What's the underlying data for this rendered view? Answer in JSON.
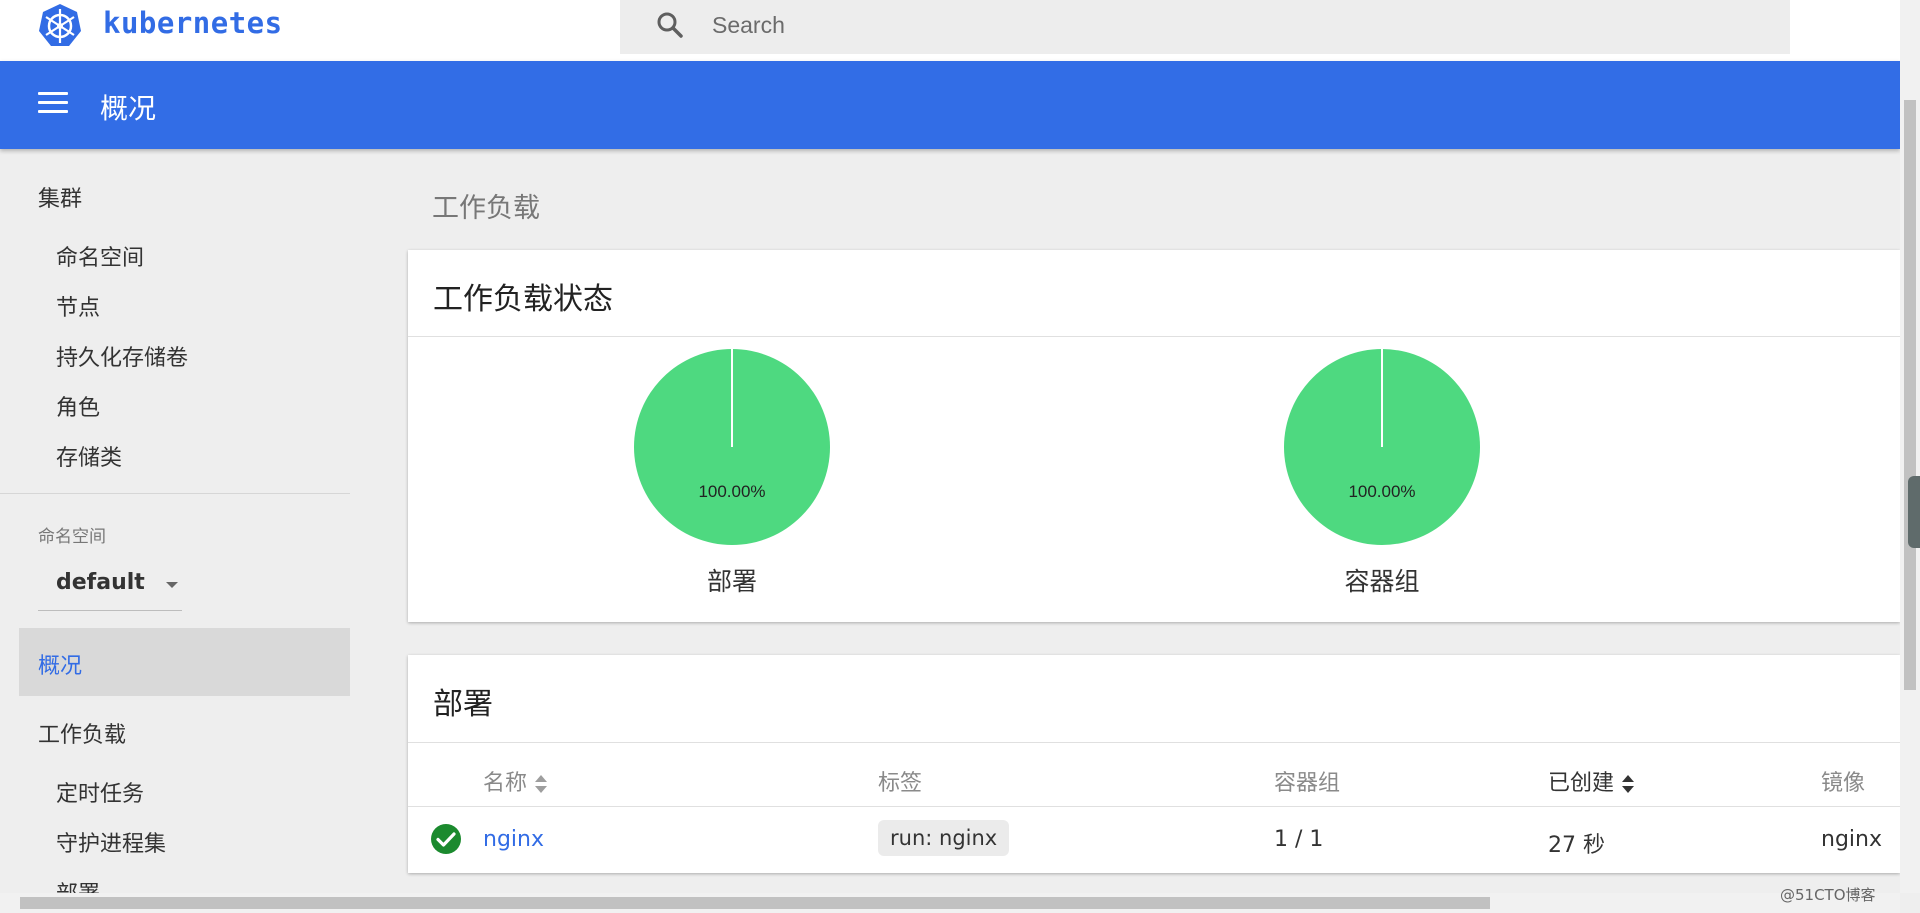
{
  "brand": {
    "name": "kubernetes",
    "color": "#326ce5"
  },
  "search": {
    "placeholder": "Search"
  },
  "header": {
    "title": "概况",
    "color": "#326de6"
  },
  "sidebar": {
    "cluster": {
      "label": "集群",
      "items": [
        "命名空间",
        "节点",
        "持久化存储卷",
        "角色",
        "存储类"
      ]
    },
    "namespace": {
      "label": "命名空间",
      "selected": "default"
    },
    "active_item": "概况",
    "workloads": {
      "label": "工作负载",
      "items": [
        "定时任务",
        "守护进程集",
        "部署"
      ]
    }
  },
  "main": {
    "heading": "工作负载",
    "status_card": {
      "title": "工作负载状态",
      "charts": [
        {
          "label": "部署",
          "value_text": "100.00%"
        },
        {
          "label": "容器组",
          "value_text": "100.00%"
        }
      ]
    },
    "deployments_card": {
      "title": "部署",
      "columns": [
        "名称",
        "标签",
        "容器组",
        "已创建",
        "镜像"
      ],
      "rows": [
        {
          "status": "running",
          "name": "nginx",
          "label": "run: nginx",
          "pods": "1 / 1",
          "created": "27 秒",
          "image": "nginx"
        }
      ]
    }
  },
  "chart_data": [
    {
      "type": "pie",
      "title": "部署",
      "slices": [
        {
          "name": "",
          "value": 100.0,
          "color": "#4ed980"
        }
      ]
    },
    {
      "type": "pie",
      "title": "容器组",
      "slices": [
        {
          "name": "",
          "value": 100.0,
          "color": "#4ed980"
        }
      ]
    }
  ],
  "watermark": "@51CTO博客",
  "colors": {
    "success": "#1b8a2e",
    "pie_fill": "#4ed980",
    "link": "#326ce5"
  }
}
